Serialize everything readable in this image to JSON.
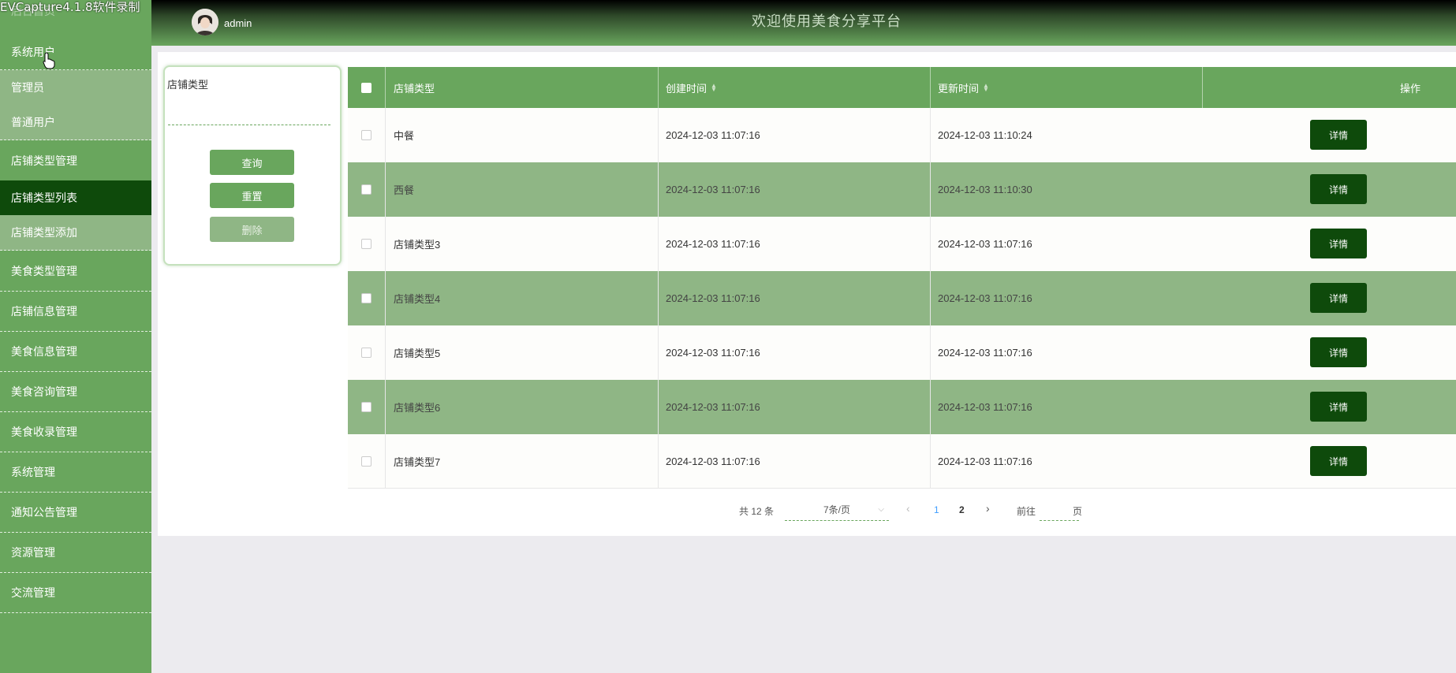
{
  "watermark": "EVCapture4.1.8软件录制",
  "header": {
    "admin_name": "admin",
    "site_title": "欢迎使用美食分享平台"
  },
  "sidebar": {
    "home": "后台首页",
    "items": [
      {
        "label": "系统用户"
      },
      {
        "label": "管理员"
      },
      {
        "label": "普通用户"
      },
      {
        "label": "店铺类型管理"
      },
      {
        "label": "店铺类型列表"
      },
      {
        "label": "店铺类型添加"
      },
      {
        "label": "美食类型管理"
      },
      {
        "label": "店铺信息管理"
      },
      {
        "label": "美食信息管理"
      },
      {
        "label": "美食咨询管理"
      },
      {
        "label": "美食收录管理"
      },
      {
        "label": "系统管理"
      },
      {
        "label": "通知公告管理"
      },
      {
        "label": "资源管理"
      },
      {
        "label": "交流管理"
      }
    ]
  },
  "search": {
    "label": "店铺类型",
    "value": "",
    "query_label": "查询",
    "reset_label": "重置",
    "delete_label": "删除"
  },
  "table": {
    "headers": {
      "type": "店铺类型",
      "created": "创建时间",
      "updated": "更新时间",
      "action": "操作"
    },
    "rows": [
      {
        "type": "中餐",
        "created": "2024-12-03 11:07:16",
        "updated": "2024-12-03 11:10:24",
        "action": "详情"
      },
      {
        "type": "西餐",
        "created": "2024-12-03 11:07:16",
        "updated": "2024-12-03 11:10:30",
        "action": "详情"
      },
      {
        "type": "店铺类型3",
        "created": "2024-12-03 11:07:16",
        "updated": "2024-12-03 11:07:16",
        "action": "详情"
      },
      {
        "type": "店铺类型4",
        "created": "2024-12-03 11:07:16",
        "updated": "2024-12-03 11:07:16",
        "action": "详情"
      },
      {
        "type": "店铺类型5",
        "created": "2024-12-03 11:07:16",
        "updated": "2024-12-03 11:07:16",
        "action": "详情"
      },
      {
        "type": "店铺类型6",
        "created": "2024-12-03 11:07:16",
        "updated": "2024-12-03 11:07:16",
        "action": "详情"
      },
      {
        "type": "店铺类型7",
        "created": "2024-12-03 11:07:16",
        "updated": "2024-12-03 11:07:16",
        "action": "详情"
      }
    ]
  },
  "pagination": {
    "total": "共 12 条",
    "page_size": "7条/页",
    "pages": [
      "1",
      "2"
    ],
    "goto_label": "前往",
    "page_unit": "页"
  },
  "colors": {
    "primary": "#69a65d",
    "row_alt": "#8fb685",
    "dark": "#0e4a0b",
    "active_page": "#409eff"
  }
}
